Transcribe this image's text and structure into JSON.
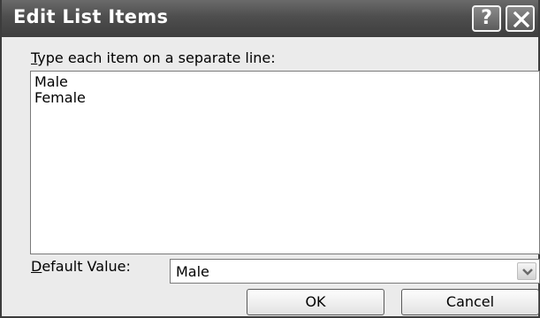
{
  "window": {
    "title": "Edit List Items",
    "help_glyph": "?",
    "help_icon": "help-icon",
    "close_icon": "close-icon"
  },
  "prompt": {
    "mnemonic": "T",
    "rest": "ype each item on a separate line:"
  },
  "list": {
    "items": [
      "Male",
      "Female"
    ]
  },
  "default_value": {
    "label_mnemonic": "D",
    "label_rest": "efault Value:",
    "selected": "Male",
    "arrow_icon": "chevron-down-icon"
  },
  "buttons": {
    "ok": "OK",
    "cancel": "Cancel"
  },
  "colors": {
    "titlebar": "#4e4e4e",
    "dialog_bg": "#ebebeb"
  }
}
